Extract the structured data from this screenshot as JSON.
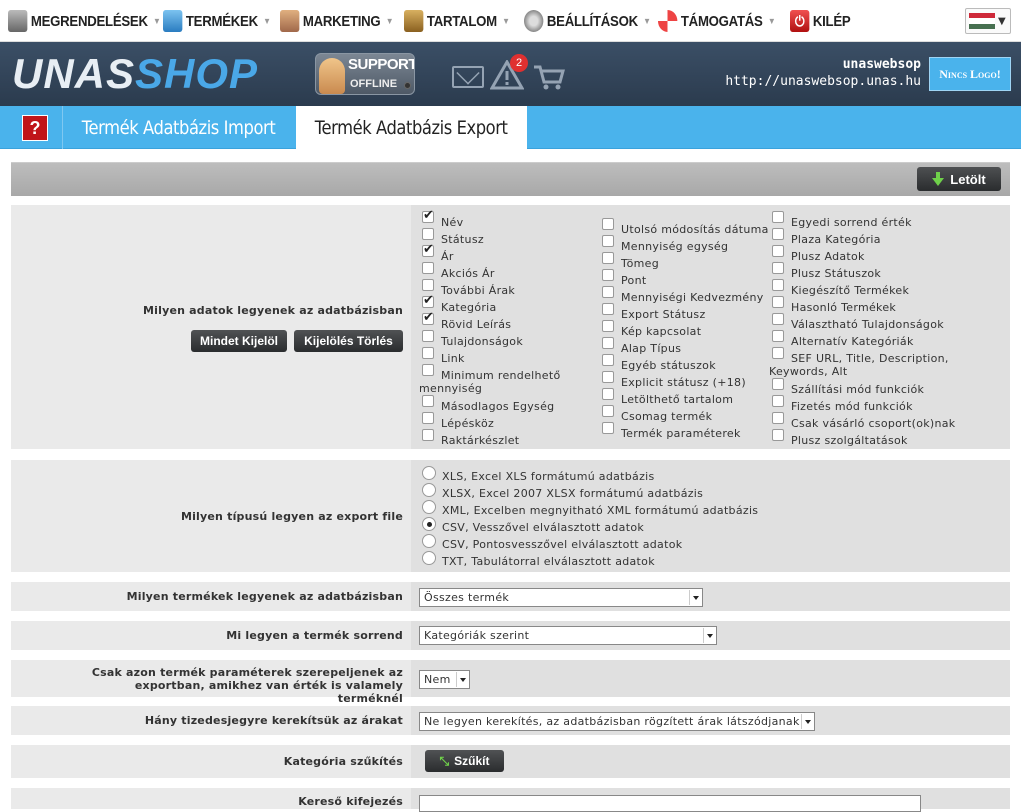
{
  "topmenu": {
    "items": [
      {
        "label": "MEGRENDELÉSEK",
        "icon": "cart-icon"
      },
      {
        "label": "TERMÉKEK",
        "icon": "gift-box-icon"
      },
      {
        "label": "MARKETING",
        "icon": "handshake-icon"
      },
      {
        "label": "TARTALOM",
        "icon": "book-icon"
      },
      {
        "label": "BEÁLLÍTÁSOK",
        "icon": "gear-icon"
      },
      {
        "label": "TÁMOGATÁS",
        "icon": "lifebuoy-icon"
      },
      {
        "label": "KILÉP",
        "icon": "power-icon"
      }
    ],
    "language": "hungarian-flag"
  },
  "header": {
    "logo_part1": "UNAS",
    "logo_part2": "SHOP",
    "support_title": "SUPPORT",
    "support_status": "OFFLINE",
    "notifications_count": "2",
    "shop_name": "unaswebsop",
    "shop_url": "http://unaswebsop.unas.hu",
    "no_logo": "Nincs Logo!"
  },
  "tabs": {
    "help": "?",
    "import": "Termék Adatbázis Import",
    "export": "Termék Adatbázis Export"
  },
  "toolbar": {
    "download": "Letölt"
  },
  "fields": {
    "label": "Milyen adatok legyenek az adatbázisban",
    "select_all": "Mindet Kijelöl",
    "clear_selection": "Kijelölés Törlés",
    "col1": [
      {
        "label": "Név",
        "checked": true
      },
      {
        "label": "Státusz",
        "checked": false
      },
      {
        "label": "Ár",
        "checked": true
      },
      {
        "label": "Akciós Ár",
        "checked": false
      },
      {
        "label": "További Árak",
        "checked": false
      },
      {
        "label": "Kategória",
        "checked": true
      },
      {
        "label": "Rövid Leírás",
        "checked": true
      },
      {
        "label": "Tulajdonságok",
        "checked": false
      },
      {
        "label": "Link",
        "checked": false
      },
      {
        "label": "Minimum rendelhető mennyiség",
        "checked": false
      },
      {
        "label": "Másodlagos Egység",
        "checked": false
      },
      {
        "label": "Lépésköz",
        "checked": false
      },
      {
        "label": "Raktárkészlet",
        "checked": false
      }
    ],
    "col2": [
      {
        "label": "Utolsó módosítás dátuma",
        "checked": false
      },
      {
        "label": "Mennyiség egység",
        "checked": false
      },
      {
        "label": "Tömeg",
        "checked": false
      },
      {
        "label": "Pont",
        "checked": false
      },
      {
        "label": "Mennyiségi Kedvezmény",
        "checked": false
      },
      {
        "label": "Export Státusz",
        "checked": false
      },
      {
        "label": "Kép kapcsolat",
        "checked": false
      },
      {
        "label": "Alap Típus",
        "checked": false
      },
      {
        "label": "Egyéb státuszok",
        "checked": false
      },
      {
        "label": "Explicit státusz (+18)",
        "checked": false
      },
      {
        "label": "Letölthető tartalom",
        "checked": false
      },
      {
        "label": "Csomag termék",
        "checked": false
      },
      {
        "label": "Termék paraméterek",
        "checked": false
      }
    ],
    "col3": [
      {
        "label": "Egyedi sorrend érték",
        "checked": false
      },
      {
        "label": "Plaza Kategória",
        "checked": false
      },
      {
        "label": "Plusz Adatok",
        "checked": false
      },
      {
        "label": "Plusz Státuszok",
        "checked": false
      },
      {
        "label": "Kiegészítő Termékek",
        "checked": false
      },
      {
        "label": "Hasonló Termékek",
        "checked": false
      },
      {
        "label": "Választható Tulajdonságok",
        "checked": false
      },
      {
        "label": "Alternatív Kategóriák",
        "checked": false
      },
      {
        "label": "SEF URL, Title, Description, Keywords, Alt",
        "checked": false
      },
      {
        "label": "Szállítási mód funkciók",
        "checked": false
      },
      {
        "label": "Fizetés mód funkciók",
        "checked": false
      },
      {
        "label": "Csak vásárló csoport(ok)nak",
        "checked": false
      },
      {
        "label": "Plusz szolgáltatások",
        "checked": false
      }
    ]
  },
  "filetype": {
    "label": "Milyen típusú legyen az export file",
    "options": [
      {
        "label": "XLS, Excel XLS formátumú adatbázis",
        "selected": false
      },
      {
        "label": "XLSX, Excel 2007 XLSX formátumú adatbázis",
        "selected": false
      },
      {
        "label": "XML, Excelben megnyitható XML formátumú adatbázis",
        "selected": false
      },
      {
        "label": "CSV, Vesszővel elválasztott adatok",
        "selected": true
      },
      {
        "label": "CSV, Pontosvesszővel elválasztott adatok",
        "selected": false
      },
      {
        "label": "TXT, Tabulátorral elválasztott adatok",
        "selected": false
      }
    ]
  },
  "products": {
    "label": "Milyen termékek legyenek az adatbázisban",
    "value": "Összes termék"
  },
  "order": {
    "label": "Mi legyen a termék sorrend",
    "value": "Kategóriák szerint"
  },
  "params": {
    "label": "Csak azon termék paraméterek szerepeljenek az exportban, amikhez van érték is valamely terméknél",
    "value": "Nem"
  },
  "rounding": {
    "label": "Hány tizedesjegyre kerekítsük az árakat",
    "value": "Ne legyen kerekítés, az adatbázisban rögzített árak látszódjanak"
  },
  "category": {
    "label": "Kategória szűkítés",
    "button": "Szűkít"
  },
  "search": {
    "label": "Kereső kifejezés",
    "value": ""
  }
}
